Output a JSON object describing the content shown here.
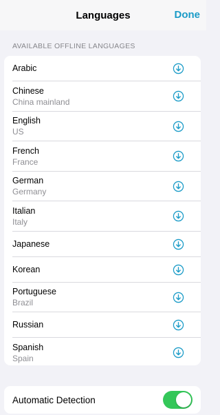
{
  "navbar": {
    "title": "Languages",
    "done_label": "Done"
  },
  "section_header": "AVAILABLE OFFLINE LANGUAGES",
  "languages": [
    {
      "name": "Arabic",
      "region": ""
    },
    {
      "name": "Chinese",
      "region": "China mainland"
    },
    {
      "name": "English",
      "region": "US"
    },
    {
      "name": "French",
      "region": "France"
    },
    {
      "name": "German",
      "region": "Germany"
    },
    {
      "name": "Italian",
      "region": "Italy"
    },
    {
      "name": "Japanese",
      "region": ""
    },
    {
      "name": "Korean",
      "region": ""
    },
    {
      "name": "Portuguese",
      "region": "Brazil"
    },
    {
      "name": "Russian",
      "region": ""
    },
    {
      "name": "Spanish",
      "region": "Spain"
    }
  ],
  "row_icon": "download-circle-icon",
  "auto_detection": {
    "label": "Automatic Detection",
    "enabled": true
  },
  "colors": {
    "accent": "#1a9bc7",
    "toggle_on": "#34c759",
    "background": "#f2f2f7"
  }
}
